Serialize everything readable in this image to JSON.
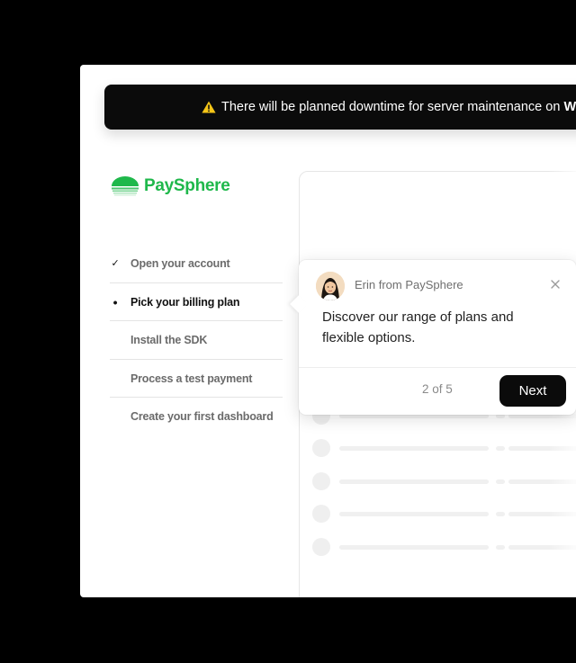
{
  "banner": {
    "icon": "warning-icon",
    "icon_color": "#f5c518",
    "message": "There will be planned downtime for server maintenance on ",
    "message_bold": "W"
  },
  "brand": {
    "name": "PaySphere",
    "color": "#1fb84b"
  },
  "steps": [
    {
      "label": "Open your account",
      "status": "done",
      "marker": "✓"
    },
    {
      "label": "Pick your billing plan",
      "status": "current",
      "marker": "•"
    },
    {
      "label": "Install the SDK",
      "status": "pending",
      "marker": ""
    },
    {
      "label": "Process a test payment",
      "status": "pending",
      "marker": ""
    },
    {
      "label": "Create your first dashboard",
      "status": "pending",
      "marker": ""
    }
  ],
  "tooltip": {
    "sender": "Erin from PaySphere",
    "message": "Discover our range of plans and flexible options.",
    "progress": "2 of 5",
    "next_label": "Next",
    "close_icon": "close-icon",
    "avatar": "avatar"
  }
}
